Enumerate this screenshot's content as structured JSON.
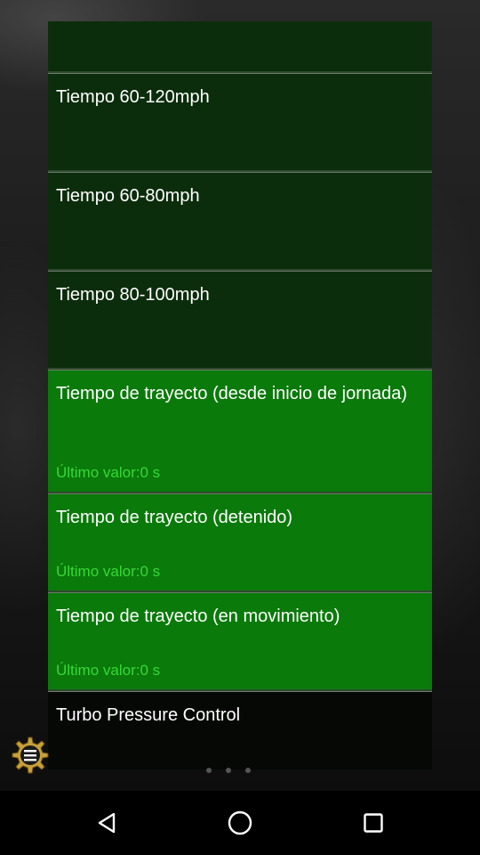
{
  "list": {
    "items": [
      {
        "title": ""
      },
      {
        "title": "Tiempo 60-120mph"
      },
      {
        "title": "Tiempo 60-80mph"
      },
      {
        "title": "Tiempo 80-100mph"
      },
      {
        "title": "Tiempo de trayecto (desde inicio de jornada)",
        "value": "Último valor:0 s"
      },
      {
        "title": "Tiempo de trayecto (detenido)",
        "value": "Último valor:0 s"
      },
      {
        "title": "Tiempo de trayecto (en movimiento)",
        "value": "Último valor:0 s"
      },
      {
        "title": "Turbo Pressure Control"
      }
    ]
  },
  "icons": {
    "settings": "gear-icon",
    "back": "back-triangle-icon",
    "home": "home-circle-icon",
    "recents": "recents-square-icon"
  },
  "colors": {
    "dark_item": "#0c2d0c",
    "bright_item": "#0a7a0a",
    "value_text": "#38d838",
    "title_text": "#ffffff"
  }
}
